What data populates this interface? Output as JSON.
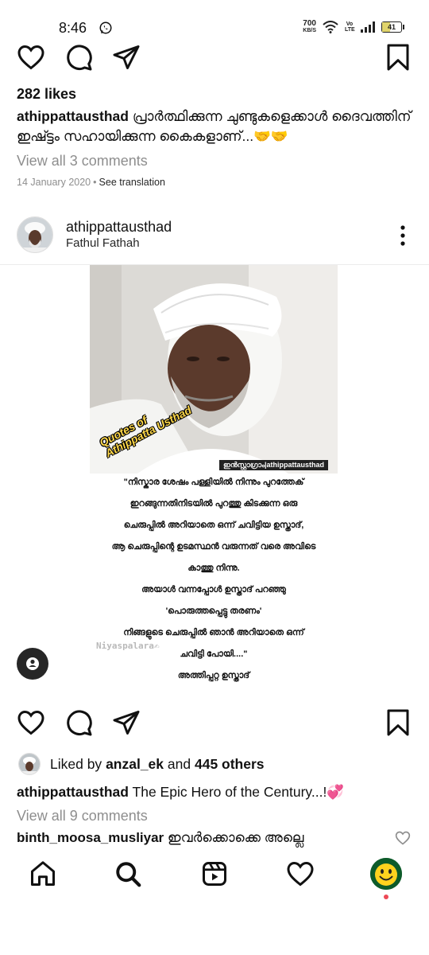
{
  "status_bar": {
    "time": "8:46",
    "net_speed_value": "700",
    "net_speed_unit": "KB/S",
    "volte": "Vo LTE",
    "battery": "41",
    "battery_level": 0.41
  },
  "post1": {
    "likes": "282 likes",
    "username": "athippattausthad",
    "caption": "പ്രാർത്ഥിക്കുന്ന ചുണ്ടുകളെക്കാൾ ദൈവത്തിന് ഇഷ്ട്ടം സഹായിക്കുന്ന കൈകളാണ്...🤝🤝",
    "view_comments": "View all 3 comments",
    "date": "14 January 2020",
    "separator": "•",
    "see_translation": "See translation"
  },
  "post2": {
    "username": "athippattausthad",
    "subtitle": "Fathul Fathah",
    "image_overlay_title_line1": "Quotes of",
    "image_overlay_title_line2": "Athippatta Usthad",
    "image_handle": "ഇൻസ്റ്റാഗ്രാം|athippattausthad",
    "quote_lines": [
      "\"നിസ്കാര ശേഷം പള്ളിയിൽ നിന്നും പുറത്തേക്",
      "ഇറങ്ങുന്നതിനിടയിൽ പുറത്തു കിടക്കുന്ന ഒരു",
      "ചെരുപ്പിൽ അറിയാതെ ഒന്ന് ചവിട്ടിയ ഉസ്താദ്,",
      "ആ ചെരുപ്പിന്റെ ഉടമസ്ഥൻ വരുന്നത് വരെ അവിടെ",
      "കാത്തു നിന്നു.",
      "അയാൾ വന്നപ്പോൾ ഉസ്താദ് പറഞ്ഞു",
      "'പൊരുത്തപ്പെട്ടു തരണം'",
      "നിങ്ങളുടെ ചെരുപ്പിൽ ഞാൻ അറിയാതെ ഒന്ന്",
      "ചവിട്ടി പോയി....\"",
      "അത്തിപ്പറ്റ ഉസ്താദ്"
    ],
    "watermark": "Niyaspalara✍",
    "liked_by_prefix": "Liked by",
    "liked_by_user": "anzal_ek",
    "liked_by_and": "and",
    "liked_by_others": "445 others",
    "caption_user": "athippattausthad",
    "caption_text": "The Epic Hero of the Century...!💞",
    "view_comments": "View all 9 comments",
    "comment_user": "binth_moosa_musliyar",
    "comment_text": "ഇവർക്കൊക്കെ അല്ലെ"
  },
  "icons": {
    "like": "heart-icon",
    "comment": "comment-icon",
    "share": "send-icon",
    "save": "bookmark-icon",
    "more": "more-vertical-icon",
    "tag": "user-tag-icon"
  },
  "bottom_nav": [
    "home-icon",
    "search-icon",
    "reels-icon",
    "activity-heart-icon",
    "profile-avatar"
  ],
  "colors": {
    "text": "#262626",
    "muted": "#8e8e8e",
    "notification_dot": "#ed4956"
  }
}
